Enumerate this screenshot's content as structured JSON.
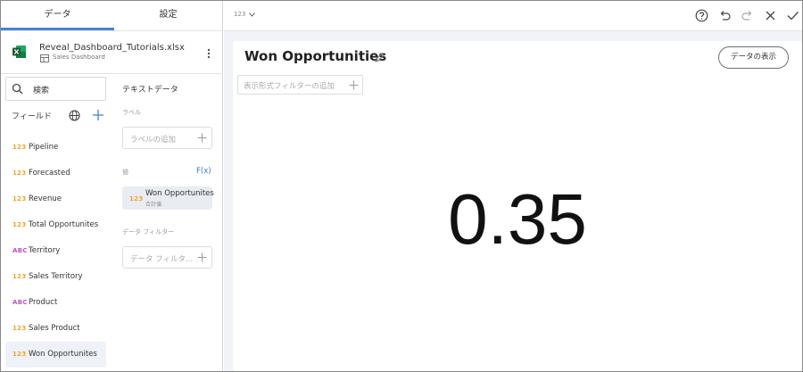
{
  "tabs": [
    {
      "label": "データ"
    },
    {
      "label": "設定"
    }
  ],
  "file": {
    "name": "Reveal_Dashboard_Tutorials.xlsx",
    "dashboard": "Sales Dashboard"
  },
  "search": {
    "label": "検索"
  },
  "fields": {
    "title": "フィールド",
    "items": [
      {
        "type": "123",
        "label": "Pipeline"
      },
      {
        "type": "123",
        "label": "Forecasted"
      },
      {
        "type": "123",
        "label": "Revenue"
      },
      {
        "type": "123",
        "label": "Total Opportunites"
      },
      {
        "type": "ABC",
        "label": "Territory"
      },
      {
        "type": "123",
        "label": "Sales Territory"
      },
      {
        "type": "ABC",
        "label": "Product"
      },
      {
        "type": "123",
        "label": "Sales Product"
      },
      {
        "type": "123",
        "label": "Won Opportunites"
      }
    ]
  },
  "config": {
    "title": "テキストデータ",
    "label_section": "ラベル",
    "label_placeholder": "ラベルの追加",
    "value_section": "値",
    "fx": "F(x)",
    "value_chip": {
      "type": "123",
      "name": "Won Opportunites",
      "agg": "合計値"
    },
    "filter_section": "データ フィルター",
    "filter_placeholder": "データ フィルタ..."
  },
  "topbar": {
    "viz_selector": "123"
  },
  "widget": {
    "title": "Won Opportunities",
    "show_data": "データの表示",
    "filter_placeholder": "表示形式フィルターの追加",
    "kpi_value": "0.35"
  },
  "colors": {
    "accent": "#4a7fd9",
    "number_type": "#f0a326",
    "text_type": "#c44fc2",
    "excel": "#1d7a45"
  },
  "icons": [
    "excel-icon",
    "dashboard-icon",
    "kebab-icon",
    "search-icon",
    "globe-icon",
    "plus-icon",
    "pencil-icon",
    "help-icon",
    "undo-icon",
    "redo-icon",
    "close-icon",
    "check-icon"
  ]
}
